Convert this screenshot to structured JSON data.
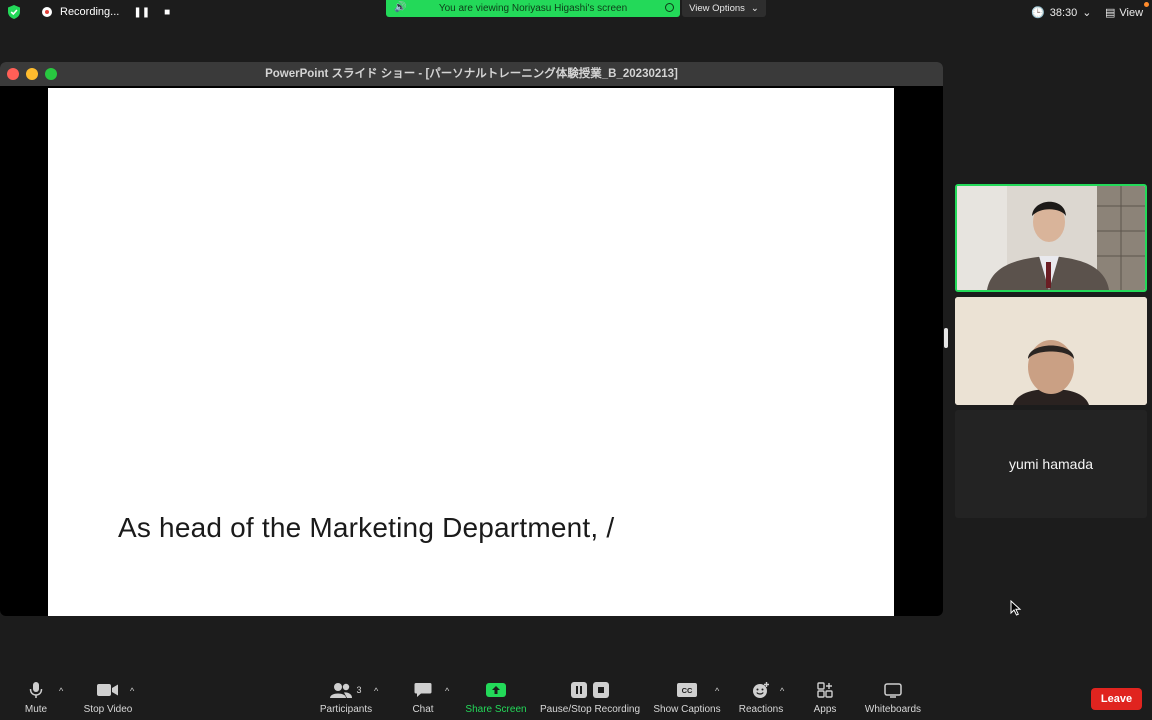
{
  "topbar": {
    "recording_label": "Recording...",
    "viewing_banner": "You are viewing Noriyasu Higashi's screen",
    "view_options_label": "View Options",
    "timer": "38:30",
    "view_label": "View"
  },
  "window": {
    "title": "PowerPoint スライド ショー - [パーソナルトレーニング体験授業_B_20230213]"
  },
  "slide": {
    "text": "As head of the Marketing Department, /"
  },
  "participants_panel": {
    "tile3_name": "yumi hamada"
  },
  "toolbar": {
    "mute": "Mute",
    "stop_video": "Stop Video",
    "participants": "Participants",
    "participants_count": "3",
    "chat": "Chat",
    "share_screen": "Share Screen",
    "pause_stop_recording": "Pause/Stop Recording",
    "show_captions": "Show Captions",
    "reactions": "Reactions",
    "apps": "Apps",
    "whiteboards": "Whiteboards",
    "leave": "Leave"
  },
  "colors": {
    "accent_green": "#23d959",
    "leave_red": "#e0241f",
    "background": "#1c1c1c"
  }
}
